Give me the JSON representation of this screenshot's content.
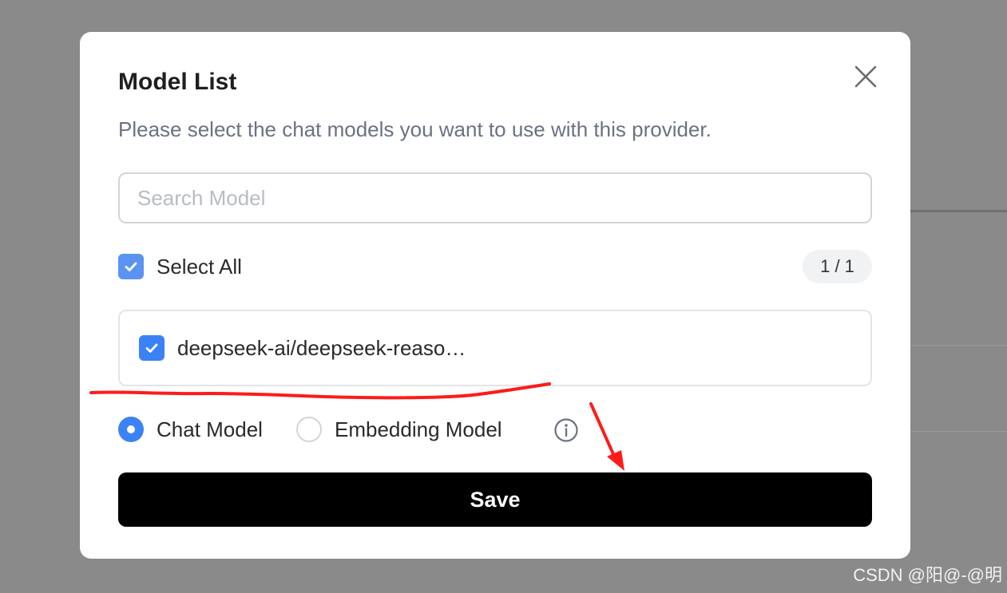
{
  "modal": {
    "title": "Model List",
    "subtitle": "Please select the chat models you want to use with this provider.",
    "search": {
      "placeholder": "Search Model",
      "value": ""
    },
    "select_all": {
      "label": "Select All",
      "checked": true,
      "count": "1 / 1"
    },
    "models": [
      {
        "name": "deepseek-ai/deepseek-reaso…",
        "checked": true
      }
    ],
    "model_type": {
      "options": [
        {
          "label": "Chat Model",
          "selected": true
        },
        {
          "label": "Embedding Model",
          "selected": false
        }
      ]
    },
    "save_label": "Save"
  },
  "annotation_color": "#ff1a1a",
  "accent": "#3b82f6",
  "watermark": "CSDN @阳@-@明"
}
